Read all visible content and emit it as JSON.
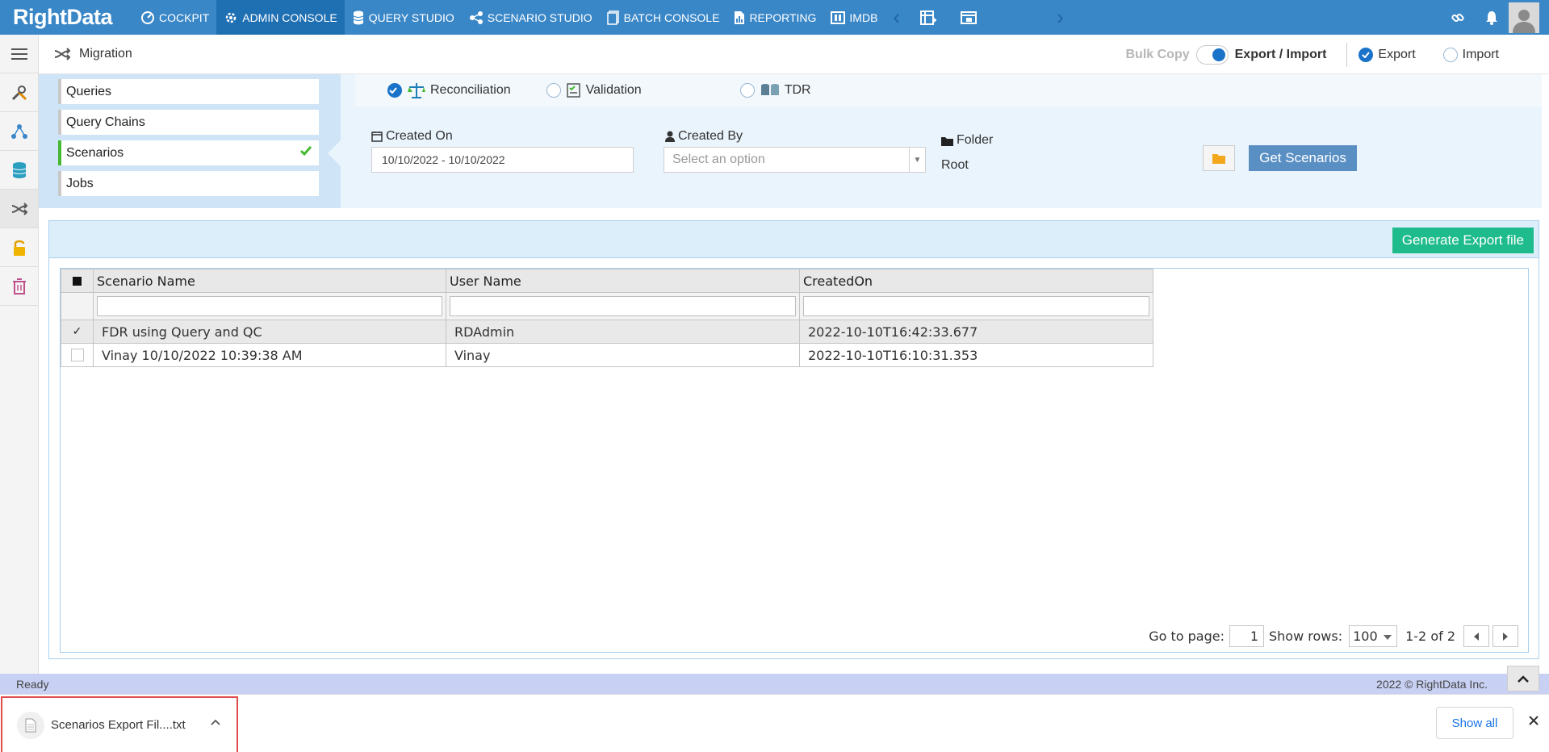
{
  "app": {
    "brand": "RightData"
  },
  "nav": {
    "items": [
      {
        "label": "COCKPIT",
        "icon": "gauge-icon"
      },
      {
        "label": "ADMIN CONSOLE",
        "icon": "gear-icon",
        "active": true
      },
      {
        "label": "QUERY STUDIO",
        "icon": "database-icon"
      },
      {
        "label": "SCENARIO STUDIO",
        "icon": "flow-icon"
      },
      {
        "label": "BATCH CONSOLE",
        "icon": "batch-icon"
      },
      {
        "label": "REPORTING",
        "icon": "report-icon"
      },
      {
        "label": "IMDB",
        "icon": "imdb-icon"
      }
    ]
  },
  "header": {
    "title": "Migration",
    "bulk_copy": "Bulk Copy",
    "export_import": "Export / Import",
    "export_label": "Export",
    "import_label": "Import",
    "mode_selected": "Export"
  },
  "sidebar": {
    "items": [
      {
        "label": "Queries"
      },
      {
        "label": "Query Chains"
      },
      {
        "label": "Scenarios",
        "active": true
      },
      {
        "label": "Jobs"
      }
    ]
  },
  "filters": {
    "types": [
      {
        "label": "Reconciliation",
        "checked": true
      },
      {
        "label": "Validation",
        "checked": false
      },
      {
        "label": "TDR",
        "checked": false
      }
    ],
    "created_on_label": "Created On",
    "created_on_value": "10/10/2022 - 10/10/2022",
    "created_by_label": "Created By",
    "created_by_placeholder": "Select an option",
    "folder_label": "Folder",
    "folder_value": "Root",
    "get_button": "Get Scenarios"
  },
  "grid": {
    "generate_button": "Generate Export file",
    "columns": [
      "Scenario Name",
      "User Name",
      "CreatedOn"
    ],
    "rows": [
      {
        "checked": true,
        "scenario": "FDR using Query and QC",
        "user": "RDAdmin",
        "created": "2022-10-10T16:42:33.677"
      },
      {
        "checked": false,
        "scenario": "Vinay 10/10/2022 10:39:38 AM",
        "user": "Vinay",
        "created": "2022-10-10T16:10:31.353"
      }
    ],
    "pager": {
      "goto_label": "Go to page:",
      "page": "1",
      "rows_label": "Show rows:",
      "rows_value": "100",
      "range": "1-2 of 2"
    }
  },
  "status": {
    "left": "Ready",
    "right": "2022 © RightData Inc."
  },
  "download": {
    "file_name": "Scenarios Export Fil....txt",
    "show_all": "Show all"
  },
  "colors": {
    "nav_bg": "#3a87c8",
    "accent": "#1a73c9",
    "success": "#46b832",
    "generate": "#1ebc8c",
    "highlight": "#e04b4b"
  }
}
